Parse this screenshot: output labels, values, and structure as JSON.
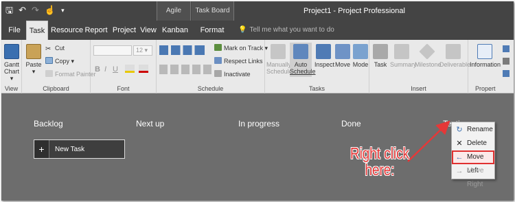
{
  "titlebar": {
    "context_agile": "Agile Tools",
    "context_board": "Task Board Tools",
    "window_title": "Project1 - Project Professional"
  },
  "tabs": [
    "File",
    "Task",
    "Resource",
    "Report",
    "Project",
    "View",
    "Kanban",
    "Format"
  ],
  "active_tab": "Task",
  "tell_me": "Tell me what you want to do",
  "ribbon": {
    "view": {
      "gantt": "Gantt",
      "chart": "Chart ▾",
      "label": "View"
    },
    "clipboard": {
      "paste": "Paste",
      "paste_arrow": "▾",
      "cut": "Cut",
      "copy": "Copy ▾",
      "format_painter": "Format Painter",
      "label": "Clipboard"
    },
    "font": {
      "size": "12",
      "bold": "B",
      "italic": "I",
      "underline": "U",
      "label": "Font"
    },
    "schedule": {
      "mark_on_track": "Mark on Track ▾",
      "respect_links": "Respect Links",
      "inactivate": "Inactivate",
      "label": "Schedule"
    },
    "tasks": {
      "manually": "Manually",
      "schedule1": "Schedule",
      "auto": "Auto",
      "schedule2": "Schedule",
      "inspect": "Inspect",
      "move": "Move",
      "mode": "Mode",
      "label": "Tasks"
    },
    "insert": {
      "task": "Task",
      "summary": "Summary",
      "milestone": "Milestone",
      "deliverable": "Deliverable",
      "label": "Insert"
    },
    "properties": {
      "information": "Information",
      "label": "Propert"
    }
  },
  "board": {
    "columns": [
      "Backlog",
      "Next up",
      "In progress",
      "Done",
      "Testi"
    ],
    "new_task_label": "New Task",
    "new_task_plus": "+"
  },
  "context_menu": {
    "items": [
      {
        "label": "Rename",
        "icon": "↻",
        "disabled": false
      },
      {
        "label": "Delete",
        "icon": "✕",
        "disabled": false
      },
      {
        "label": "Move Left",
        "icon": "←",
        "disabled": false
      },
      {
        "label": "Move Right",
        "icon": "→",
        "disabled": true
      }
    ]
  },
  "annotation": {
    "line1": "Right click",
    "line2": "here:"
  },
  "colors": {
    "accent": "#e53838",
    "board": "#6d6d6d",
    "titlebar": "#444444",
    "ribbon": "#e9e9e9"
  }
}
